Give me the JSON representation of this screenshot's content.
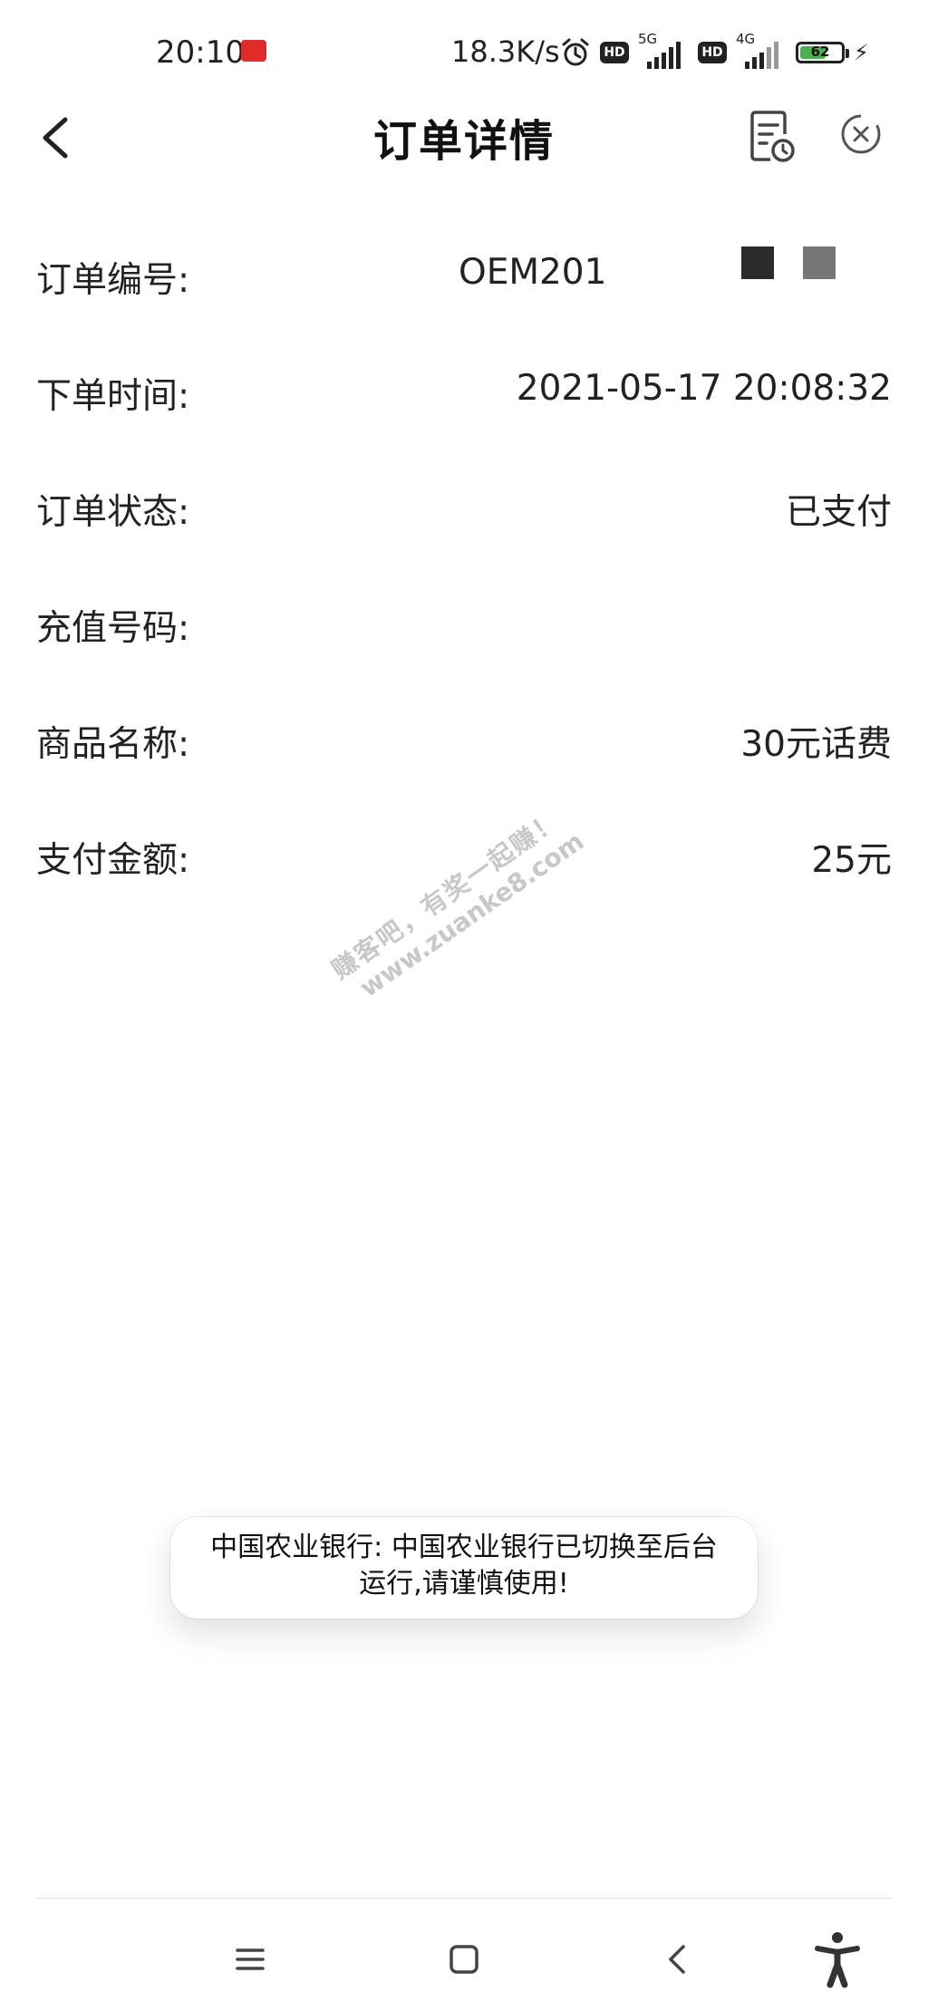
{
  "status_bar": {
    "time": "20:10",
    "speed": "18.3K/s",
    "hd1": "HD",
    "net1": "5G",
    "hd2": "HD",
    "net2": "4G",
    "battery": "62",
    "icons": [
      "app-notification-icon",
      "alarm-icon",
      "hd-icon",
      "signal-5g-icon",
      "hd-icon",
      "signal-4g-icon",
      "battery-icon",
      "charging-icon"
    ]
  },
  "header": {
    "title": "订单详情",
    "back_icon": "chevron-left-icon",
    "doc_icon": "document-clock-icon",
    "close_icon": "close-circle-icon"
  },
  "order": {
    "rows": [
      {
        "label": "订单编号:",
        "value": "OEM201"
      },
      {
        "label": "下单时间:",
        "value": "2021-05-17 20:08:32"
      },
      {
        "label": "订单状态:",
        "value": "已支付"
      },
      {
        "label": "充值号码:",
        "value": ""
      },
      {
        "label": "商品名称:",
        "value": "30元话费"
      },
      {
        "label": "支付金额:",
        "value": "25元"
      }
    ]
  },
  "watermark": {
    "line1": "赚客吧，有奖一起赚！",
    "line2": "www.zuanke8.com"
  },
  "toast": {
    "text": "中国农业银行: 中国农业银行已切换至后台运行,请谨慎使用!"
  },
  "nav_bar": {
    "icons": [
      "menu-icon",
      "home-square-icon",
      "back-icon",
      "accessibility-icon"
    ]
  },
  "colors": {
    "background": "#ffffff",
    "text": "#222222",
    "battery_fill": "#4caf50",
    "watermark": "#c8c8c8"
  }
}
